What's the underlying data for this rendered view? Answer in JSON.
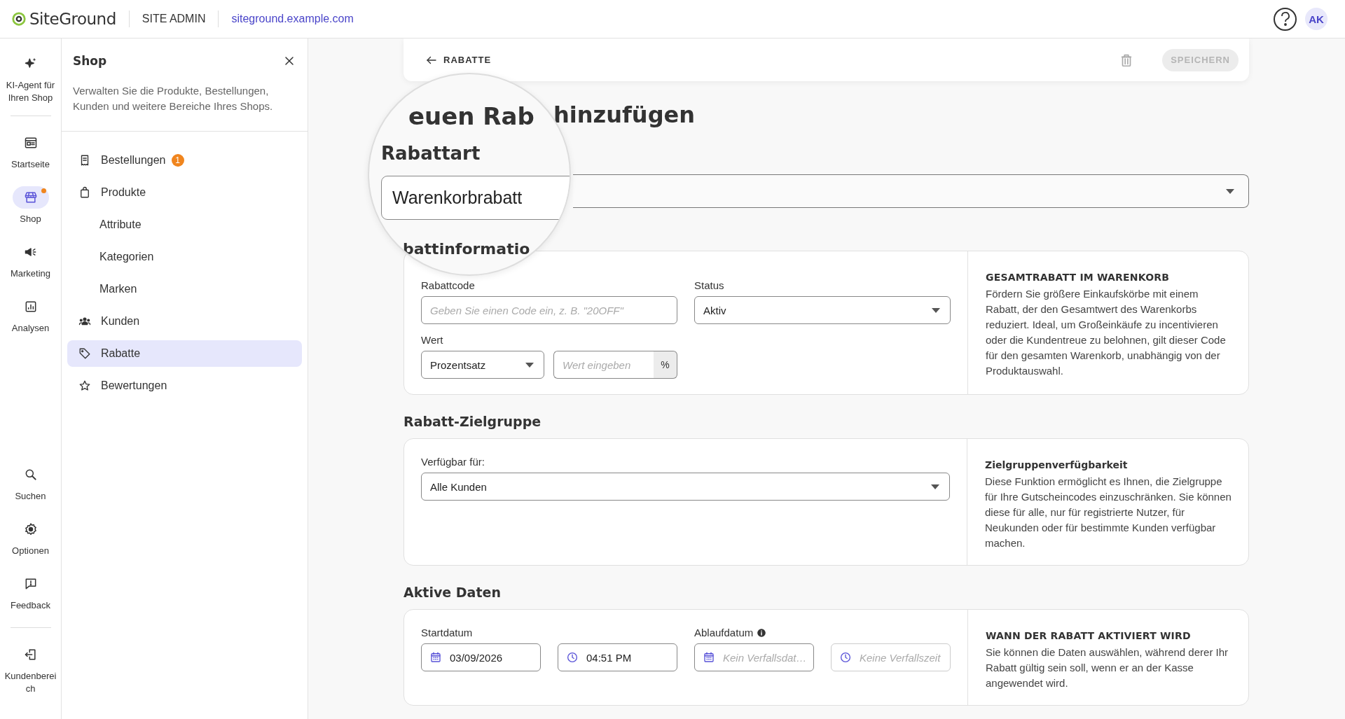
{
  "header": {
    "logo": "SiteGround",
    "section": "SITE ADMIN",
    "site_link": "siteground.example.com",
    "avatar": "AK"
  },
  "rail": {
    "top": [
      {
        "label": "KI-Agent für Ihren Shop",
        "selected": false,
        "notification": false
      },
      {
        "label": "Startseite",
        "selected": false,
        "notification": false
      },
      {
        "label": "Shop",
        "selected": true,
        "notification": true
      },
      {
        "label": "Marketing",
        "selected": false,
        "notification": false
      },
      {
        "label": "Analysen",
        "selected": false,
        "notification": false
      }
    ],
    "bottom": [
      {
        "label": "Suchen",
        "selected": false
      },
      {
        "label": "Optionen",
        "selected": false
      },
      {
        "label": "Feedback",
        "selected": false
      },
      {
        "label": "Kundenbereich",
        "selected": false
      }
    ]
  },
  "panel": {
    "title": "Shop",
    "description": "Verwalten Sie die Produkte, Bestellungen, Kunden und weitere Bereiche Ihres Shops.",
    "items": [
      {
        "label": "Bestellungen",
        "badge": "1",
        "selected": false
      },
      {
        "label": "Produkte",
        "selected": false,
        "children": [
          {
            "label": "Attribute",
            "selected": false
          },
          {
            "label": "Kategorien",
            "selected": false
          },
          {
            "label": "Marken",
            "selected": false
          }
        ]
      },
      {
        "label": "Kunden",
        "selected": false
      },
      {
        "label": "Rabatte",
        "selected": true
      },
      {
        "label": "Bewertungen",
        "selected": false
      }
    ]
  },
  "toolbar": {
    "back": "RABATTE",
    "save": "SPEICHERN",
    "save_disabled": true,
    "delete_disabled": true
  },
  "title": "hinzufügen",
  "magnifier": {
    "title": "euen Rab",
    "heading": "Rabattart",
    "select_value": "Warenkorbrabatt",
    "section": "battinformatio"
  },
  "discount_info": {
    "code_label": "Rabattcode",
    "code_placeholder": "Geben Sie einen Code ein, z. B. \"20OFF\"",
    "status_label": "Status",
    "status_value": "Aktiv",
    "value_label": "Wert",
    "value_type": "Prozentsatz",
    "value_placeholder": "Wert eingeben",
    "value_suffix": "%",
    "aside_title": "GESAMTRABATT IM WARENKORB",
    "aside_text": "Fördern Sie größere Einkaufskörbe mit einem Rabatt, der den Gesamtwert des Warenkorbs reduziert. Ideal, um Großeinkäufe zu incentivieren oder die Kundentreue zu belohnen, gilt dieser Code für den gesamten Warenkorb, unabhängig von der Produktauswahl."
  },
  "audience": {
    "heading": "Rabatt-Zielgruppe",
    "label": "Verfügbar für:",
    "value": "Alle Kunden",
    "aside_title": "Zielgruppenverfügbarkeit",
    "aside_text": "Diese Funktion ermöglicht es Ihnen, die Zielgruppe für Ihre Gutscheincodes einzuschränken. Sie können diese für alle, nur für registrierte Nutzer, für Neukunden oder für bestimmte Kunden verfügbar machen."
  },
  "active_dates": {
    "heading": "Aktive Daten",
    "start_label": "Startdatum",
    "start_date": "03/09/2026",
    "start_time": "04:51 PM",
    "end_label": "Ablaufdatum",
    "end_date_placeholder": "Kein Verfallsdat…",
    "end_time_placeholder": "Keine Verfallszeit",
    "end_time_disabled": true,
    "aside_title": "WANN DER RABATT AKTIVIERT WIRD",
    "aside_text": "Sie können die Daten auswählen, während derer Ihr Rabatt gültig sein soll, wenn er an der Kasse angewendet wird."
  }
}
